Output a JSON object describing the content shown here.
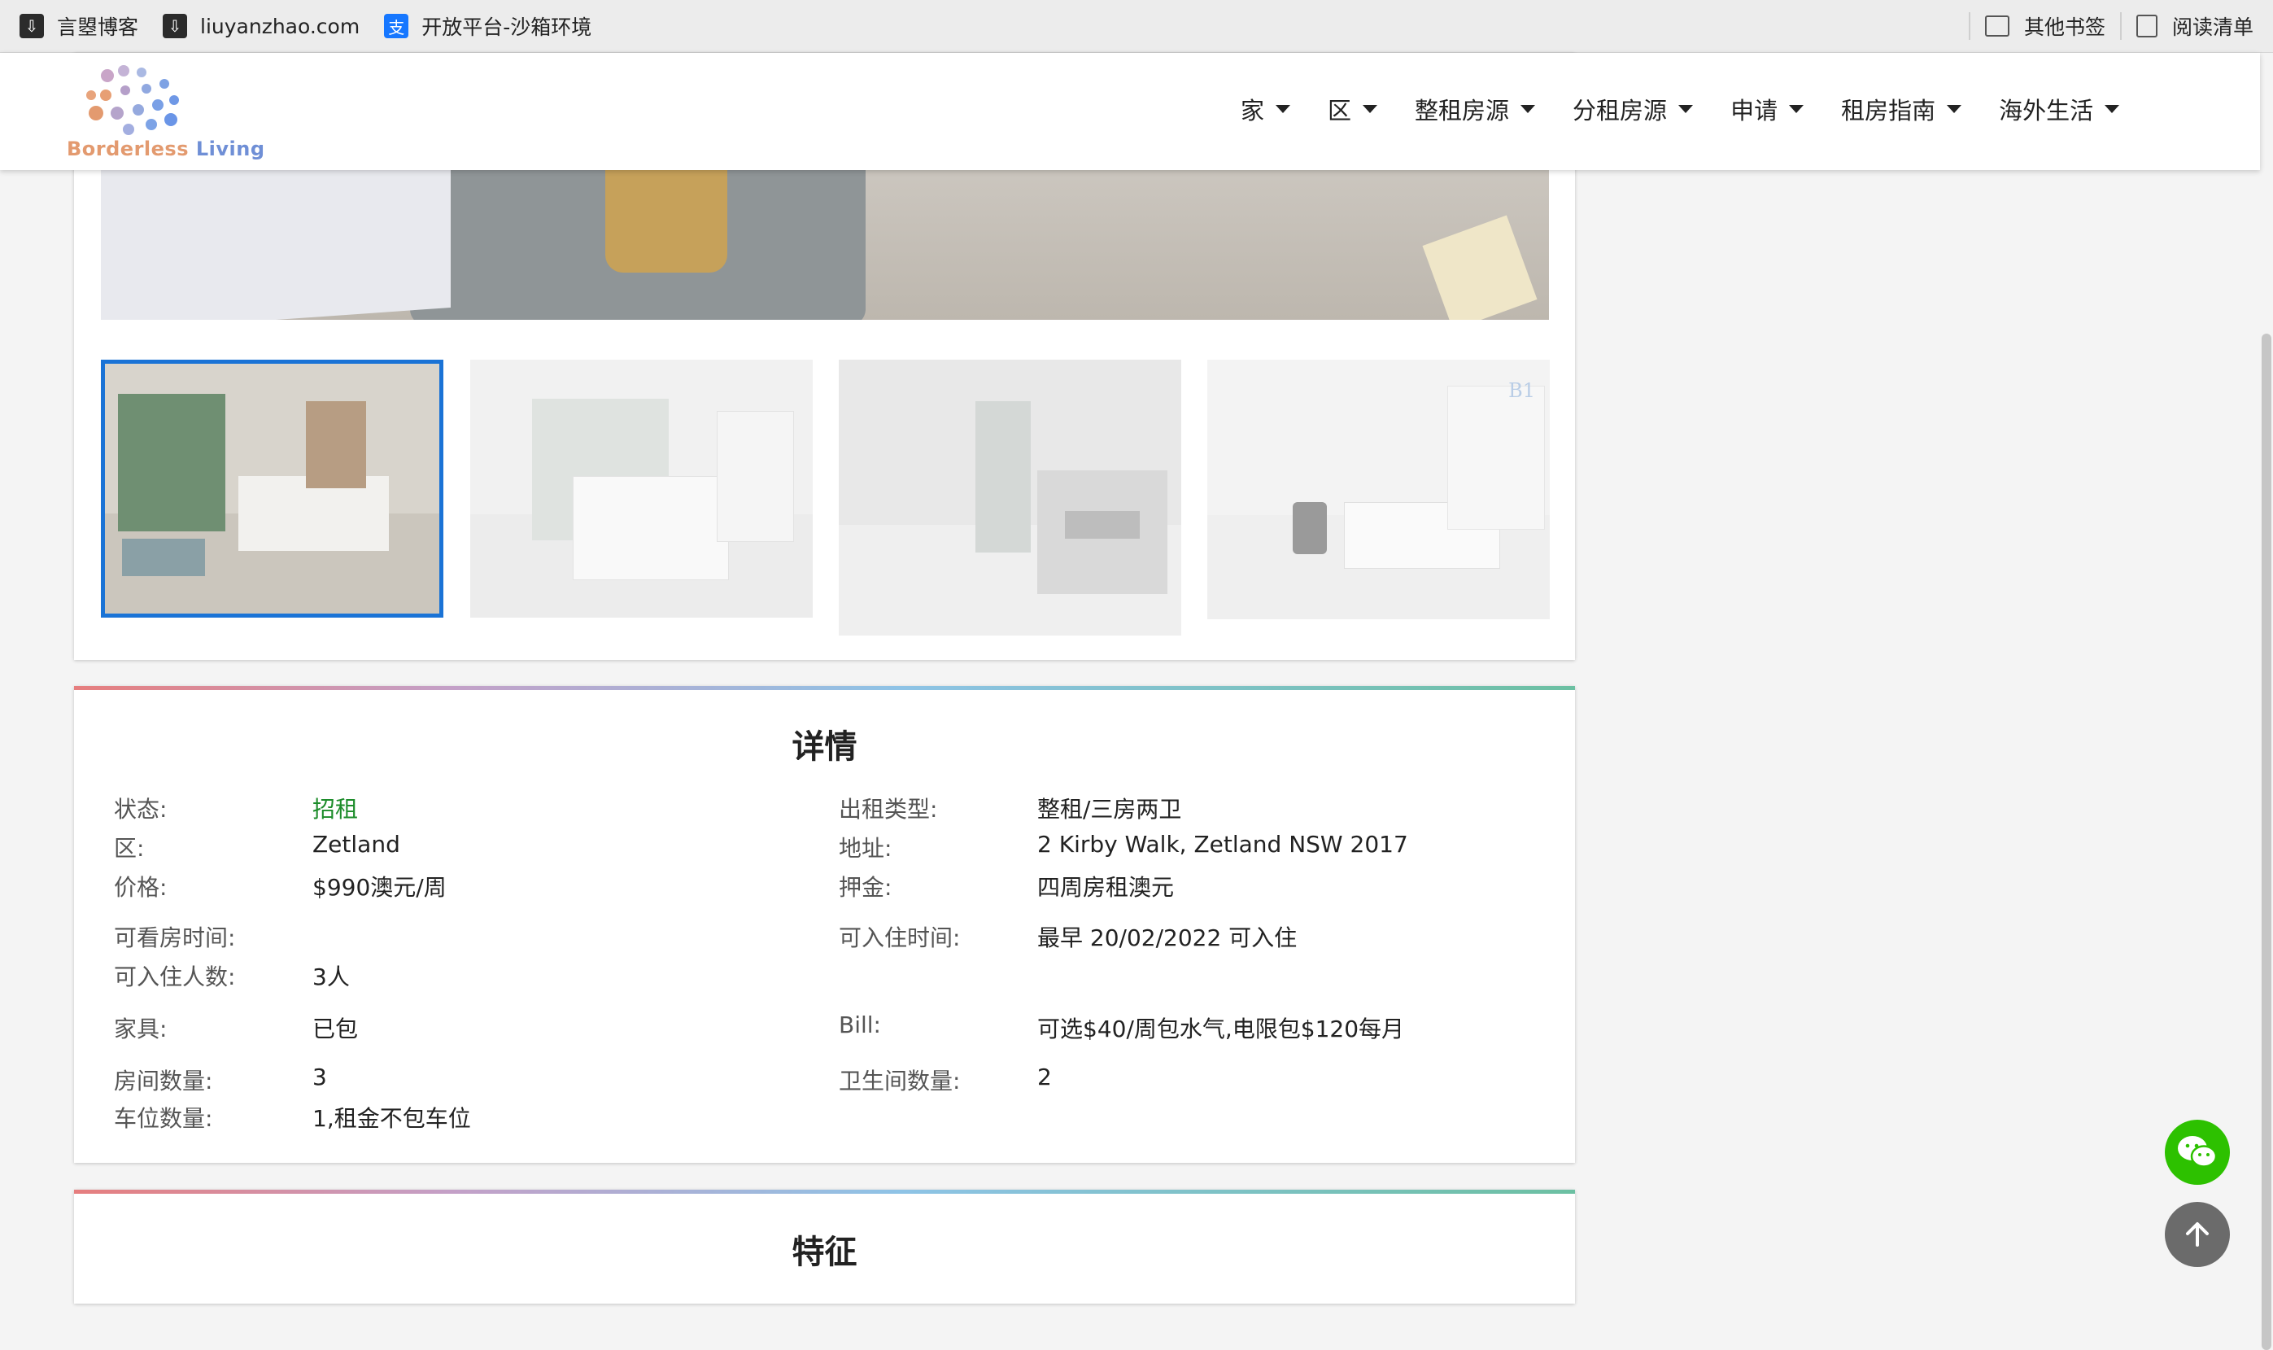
{
  "bookmarks": {
    "items": [
      {
        "label": "言曌博客",
        "icon": "bookmark-site-icon"
      },
      {
        "label": "liuyanzhao.com",
        "icon": "bookmark-site-icon"
      },
      {
        "label": "开放平台-沙箱环境",
        "icon": "alipay-icon"
      }
    ],
    "other_label": "其他书签",
    "reading_list_label": "阅读清单"
  },
  "header": {
    "logo_text_1": "Borderless ",
    "logo_text_2": "Living",
    "nav": [
      "家",
      "区",
      "整租房源",
      "分租房源",
      "申请",
      "租房指南",
      "海外生活"
    ]
  },
  "details": {
    "title": "详情",
    "left": [
      {
        "label": "状态:",
        "value": "招租"
      },
      {
        "label": "区:",
        "value": "Zetland"
      },
      {
        "label": "价格:",
        "value": "$990澳元/周"
      },
      {
        "label": "可看房时间:",
        "value": ""
      },
      {
        "label": "可入住人数:",
        "value": "3人"
      },
      {
        "label": "家具:",
        "value": "已包"
      },
      {
        "label": "房间数量:",
        "value": "3"
      },
      {
        "label": "车位数量:",
        "value": "1,租金不包车位"
      }
    ],
    "right": [
      {
        "label": "出租类型:",
        "value": "整租/三房两卫"
      },
      {
        "label": "地址:",
        "value": "2 Kirby Walk, Zetland NSW 2017"
      },
      {
        "label": "押金:",
        "value": "四周房租澳元"
      },
      {
        "label": "可入住时间:",
        "value": "最早 20/02/2022 可入住"
      },
      {
        "label": "Bill:",
        "value": "可选$40/周包水气,电限包$120每月"
      },
      {
        "label": "卫生间数量:",
        "value": "2"
      }
    ]
  },
  "features": {
    "title": "特征"
  },
  "gallery": {
    "thumb_watermark": "B1"
  },
  "colors": {
    "accent_blue": "#1a73d6",
    "status_green": "#1c8c2a",
    "wechat_green": "#2dc100"
  }
}
